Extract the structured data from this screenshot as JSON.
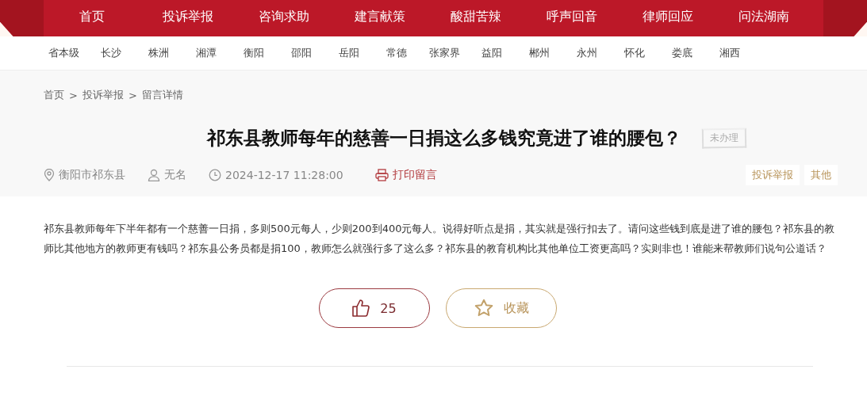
{
  "main_nav": [
    "首页",
    "投诉举报",
    "咨询求助",
    "建言献策",
    "酸甜苦辣",
    "呼声回音",
    "律师回应",
    "问法湖南"
  ],
  "region_nav": [
    "省本级",
    "长沙",
    "株洲",
    "湘潭",
    "衡阳",
    "邵阳",
    "岳阳",
    "常德",
    "张家界",
    "益阳",
    "郴州",
    "永州",
    "怀化",
    "娄底",
    "湘西"
  ],
  "breadcrumb": [
    "首页",
    "投诉举报",
    "留言详情"
  ],
  "breadcrumb_separator": ">",
  "title": "祁东县教师每年的慈善一日捐这么多钱究竟进了谁的腰包？",
  "status": "未办理",
  "meta": {
    "location": "衡阳市祁东县",
    "author": "无名",
    "time": "2024-12-17 11:28:00",
    "print": "打印留言"
  },
  "tags": [
    "投诉举报",
    "其他"
  ],
  "body": "祁东县教师每年下半年都有一个慈善一日捐，多则500元每人，少则200到400元每人。说得好听点是捐，其实就是强行扣去了。请问这些钱到底是进了谁的腰包？祁东县的教师比其他地方的教师更有钱吗？祁东县公务员都是捐100，教师怎么就强行多了这么多？祁东县的教育机构比其他单位工资更高吗？实则非也！谁能来帮教师们说句公道话？",
  "actions": {
    "likes": "25",
    "favorite": "收藏"
  }
}
